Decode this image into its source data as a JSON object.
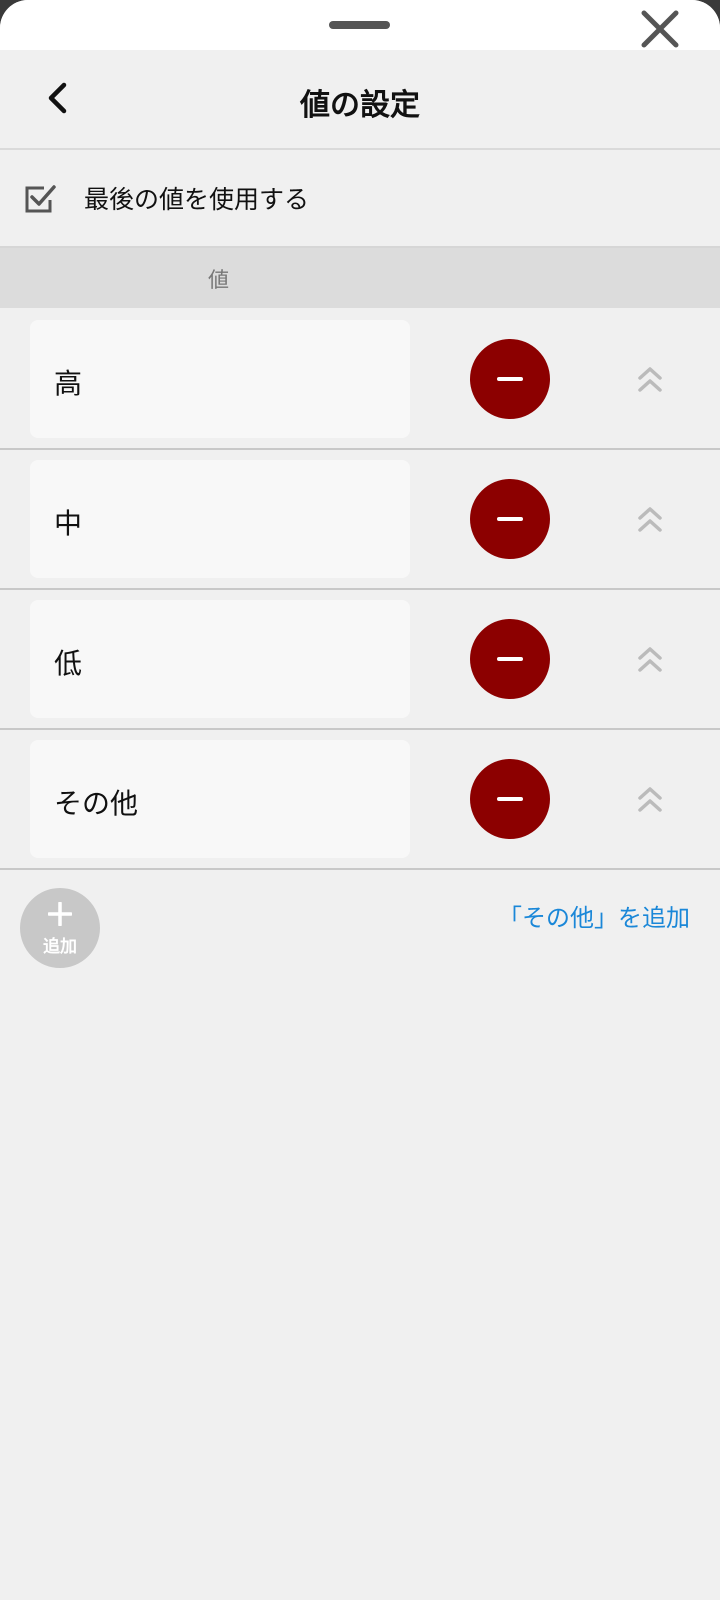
{
  "header": {
    "title": "値の設定",
    "back_icon": "chevron-left-icon",
    "close_icon": "close-icon"
  },
  "use_last_value": {
    "label": "最後の値を使用する",
    "checked": true
  },
  "table": {
    "column_header": "値",
    "rows": [
      {
        "value": "高"
      },
      {
        "value": "中"
      },
      {
        "value": "低"
      },
      {
        "value": "その他"
      }
    ]
  },
  "footer": {
    "add_label": "追加",
    "add_other_link": "「その他」を追加"
  },
  "colors": {
    "remove": "#8c0000",
    "link": "#1a87d8",
    "add_button": "#c8c8c8"
  }
}
